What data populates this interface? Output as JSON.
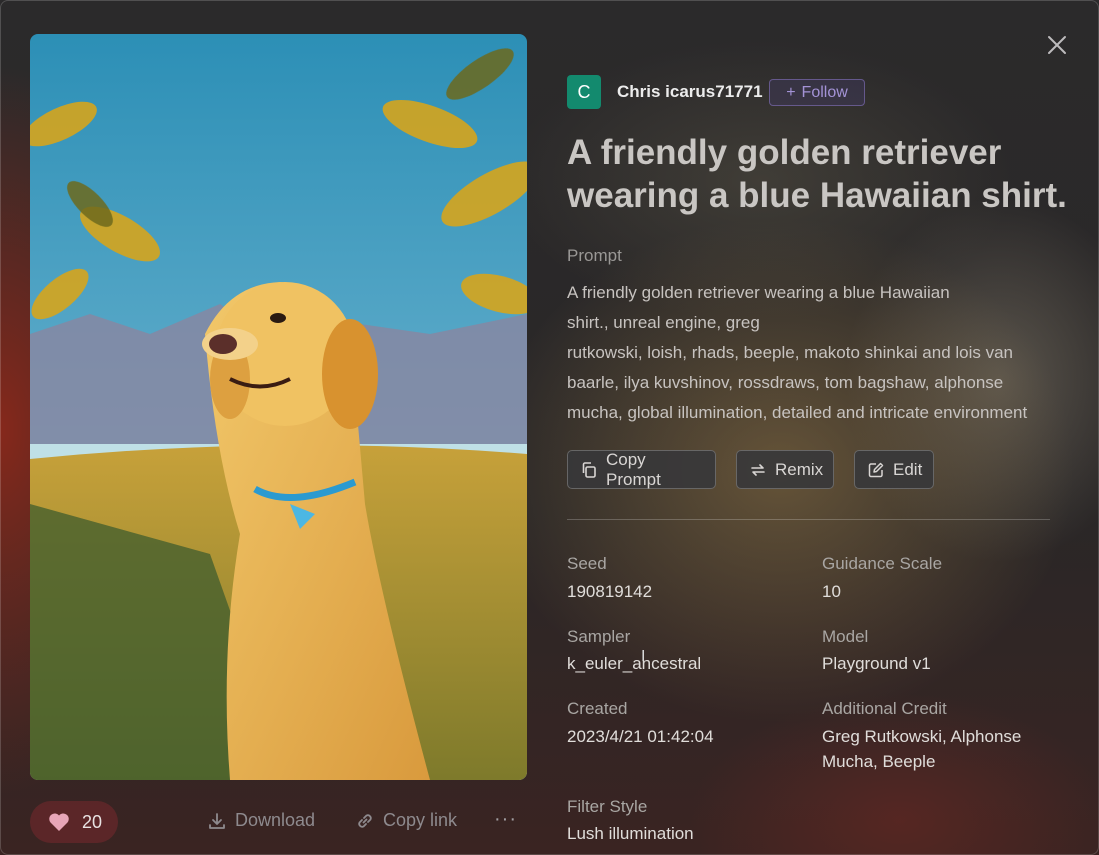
{
  "author": {
    "avatar_letter": "C",
    "name": "Chris icarus71771",
    "follow_label": "Follow"
  },
  "title": "A friendly golden retriever wearing a blue Hawaiian shirt.",
  "prompt": {
    "label": "Prompt",
    "lines": [
      "A friendly golden retriever wearing a blue Hawaiian",
      "shirt., unreal engine, greg",
      "rutkowski, loish, rhads, beeple, makoto shinkai and lois van",
      "baarle, ilya kuvshinov, rossdraws, tom bagshaw, alphonse",
      "mucha, global illumination, detailed and intricate environment"
    ]
  },
  "actions": {
    "copy_prompt": "Copy Prompt",
    "remix": "Remix",
    "edit": "Edit"
  },
  "details": {
    "seed_label": "Seed",
    "seed": "190819142",
    "guidance_label": "Guidance Scale",
    "guidance": "10",
    "sampler_label": "Sampler",
    "sampler": "k_euler_ancestral",
    "model_label": "Model",
    "model": "Playground v1",
    "created_label": "Created",
    "created": "2023/4/21 01:42:04",
    "credit_label": "Additional Credit",
    "credit_line1": "Greg Rutkowski, Alphonse",
    "credit_line2": "Mucha, Beeple",
    "filter_label": "Filter Style",
    "filter": "Lush illumination"
  },
  "footer": {
    "likes": "20",
    "download": "Download",
    "copy_link": "Copy link",
    "more": "···"
  },
  "colors": {
    "avatar": "#138a6e",
    "like_heart": "#e8a6b8",
    "follow": "#a493d6"
  }
}
